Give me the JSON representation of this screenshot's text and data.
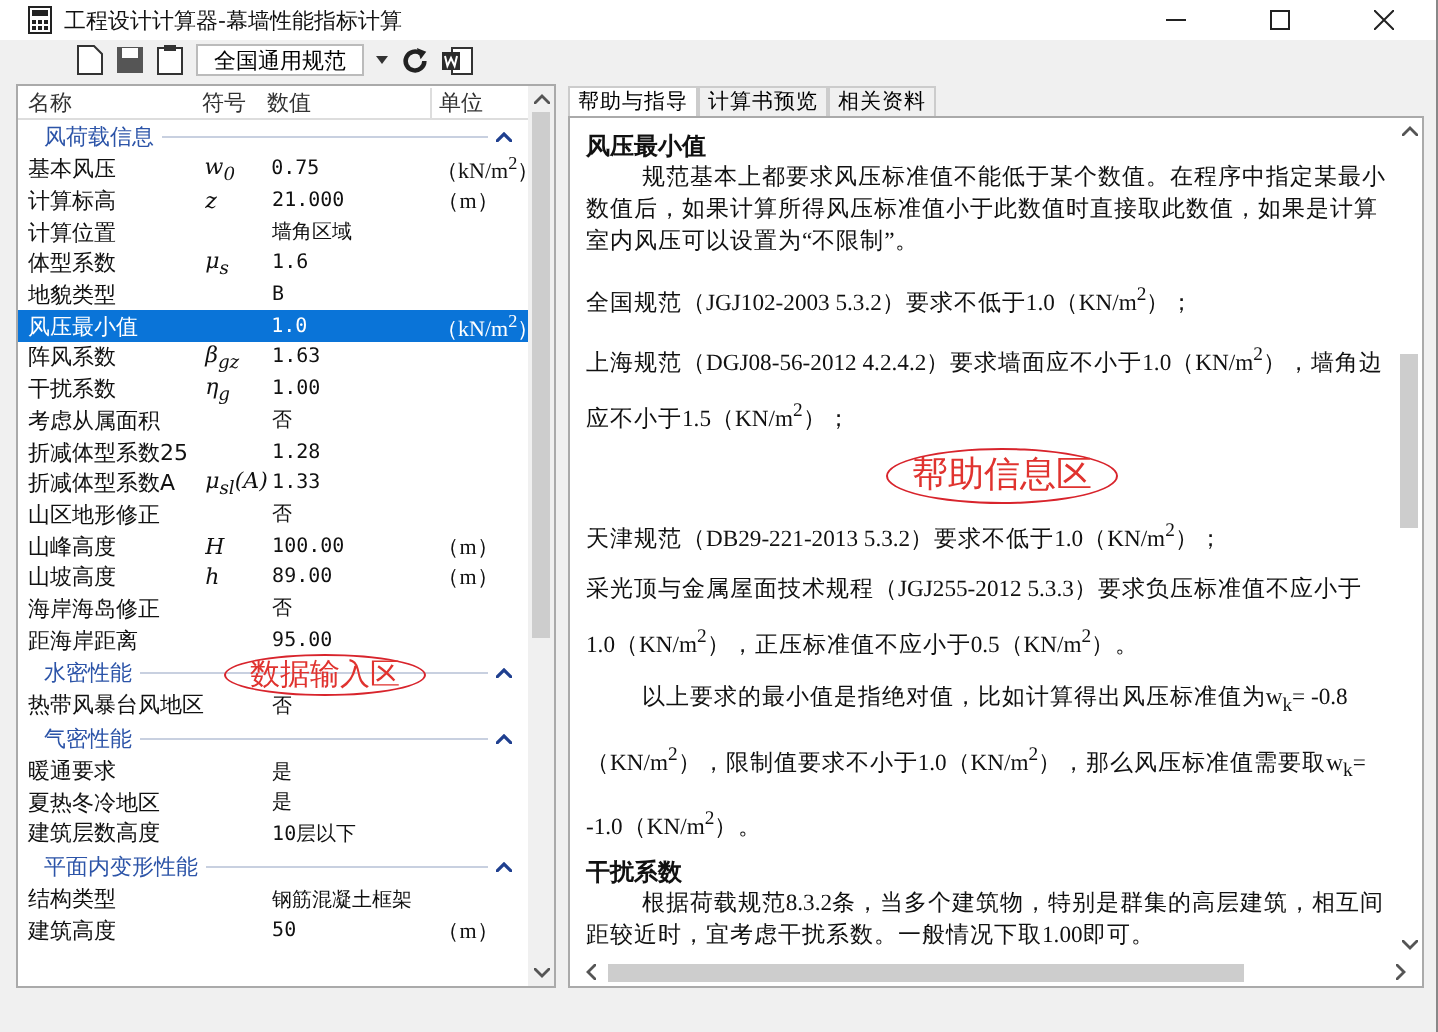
{
  "window": {
    "title": "工程设计计算器-幕墙性能指标计算"
  },
  "toolbar": {
    "standard": "全国通用规范"
  },
  "input_table": {
    "columns": [
      "名称",
      "符号",
      "数值",
      "单位"
    ],
    "sections": [
      {
        "title": "风荷载信息",
        "expanded": true,
        "rows": [
          {
            "name": "基本风压",
            "symbol": "w$_{0}$",
            "value": "0.75",
            "unit": "（kN/m$^{2}$）",
            "selected": false
          },
          {
            "name": "计算标高",
            "symbol": "z",
            "value": "21.000",
            "unit": "（m）",
            "selected": false
          },
          {
            "name": "计算位置",
            "symbol": "",
            "value": "墙角区域",
            "unit": "",
            "selected": false
          },
          {
            "name": "体型系数",
            "symbol": "μ$_{s}$",
            "value": "1.6",
            "unit": "",
            "selected": false
          },
          {
            "name": "地貌类型",
            "symbol": "",
            "value": "B",
            "unit": "",
            "selected": false
          },
          {
            "name": "风压最小值",
            "symbol": "",
            "value": "1.0",
            "unit": "（kN/m$^{2}$）",
            "selected": true
          },
          {
            "name": "阵风系数",
            "symbol": "β$_{gz}$",
            "value": "1.63",
            "unit": "",
            "selected": false
          },
          {
            "name": "干扰系数",
            "symbol": "η$_{g}$",
            "value": "1.00",
            "unit": "",
            "selected": false
          },
          {
            "name": "考虑从属面积",
            "symbol": "",
            "value": "否",
            "unit": "",
            "selected": false
          },
          {
            "name": "折减体型系数25",
            "symbol": "",
            "value": "1.28",
            "unit": "",
            "selected": false
          },
          {
            "name": "折减体型系数A",
            "symbol": "μ$_{sl}$(A)",
            "value": "1.33",
            "unit": "",
            "selected": false
          },
          {
            "name": "山区地形修正",
            "symbol": "",
            "value": "否",
            "unit": "",
            "selected": false
          },
          {
            "name": "山峰高度",
            "symbol": "H",
            "value": "100.00",
            "unit": "（m）",
            "selected": false
          },
          {
            "name": "山坡高度",
            "symbol": "h",
            "value": "89.00",
            "unit": "（m）",
            "selected": false
          },
          {
            "name": "海岸海岛修正",
            "symbol": "",
            "value": "否",
            "unit": "",
            "selected": false
          },
          {
            "name": "距海岸距离",
            "symbol": "",
            "value": "95.00",
            "unit": "",
            "selected": false
          }
        ]
      },
      {
        "title": "水密性能",
        "expanded": true,
        "rows": [
          {
            "name": "热带风暴台风地区",
            "symbol": "",
            "value": "否",
            "unit": "",
            "selected": false
          }
        ]
      },
      {
        "title": "气密性能",
        "expanded": true,
        "rows": [
          {
            "name": "暖通要求",
            "symbol": "",
            "value": "是",
            "unit": "",
            "selected": false
          },
          {
            "name": "夏热冬冷地区",
            "symbol": "",
            "value": "是",
            "unit": "",
            "selected": false
          },
          {
            "name": "建筑层数高度",
            "symbol": "",
            "value": "10层以下",
            "unit": "",
            "selected": false
          }
        ]
      },
      {
        "title": "平面内变形性能",
        "expanded": true,
        "rows": [
          {
            "name": "结构类型",
            "symbol": "",
            "value": "钢筋混凝土框架",
            "unit": "",
            "selected": false
          },
          {
            "name": "建筑高度",
            "symbol": "",
            "value": "50",
            "unit": "（m）",
            "selected": false
          }
        ]
      }
    ]
  },
  "tabs": [
    {
      "label": "帮助与指导",
      "selected": true
    },
    {
      "label": "计算书预览",
      "selected": false
    },
    {
      "label": "相关资料",
      "selected": false
    }
  ],
  "help": [
    {
      "kind": "heading",
      "text": "风压最小值"
    },
    {
      "kind": "indent",
      "text": "规范基本上都要求风压标准值不能低于某个数值。在程序中指定某最小数值后，如果计算所得风压标准值小于此数值时直接取此数值，如果是计算室内风压可以设置为“不限制”。"
    },
    {
      "kind": "loose",
      "text": "全国规范（JGJ102-2003 5.3.2）要求不低于1.0（KN/m$^{2}$）；"
    },
    {
      "kind": "loose",
      "text": "上海规范（DGJ08-56-2012  4.2.4.2）要求墙面应不小于1.0（KN/m$^{2}$），墙角边应不小于1.5（KN/m$^{2}$）；"
    },
    {
      "kind": "annotation",
      "text": "帮助信息区"
    },
    {
      "kind": "loose",
      "text": "天津规范（DB29-221-2013 5.3.2）要求不低于1.0（KN/m$^{2}$）；"
    },
    {
      "kind": "loose",
      "text": "采光顶与金属屋面技术规程（JGJ255-2012 5.3.3）要求负压标准值不应小于1.0（KN/m$^{2}$），正压标准值不应小于0.5（KN/m$^{2}$）。"
    },
    {
      "kind": "loose-indent",
      "text": "以上要求的最小值是指绝对值，比如计算得出风压标准值为w$_{k}$= -0.8（KN/m$^{2}$），限制值要求不小于1.0（KN/m$^{2}$），那么风压标准值需要取w$_{k}$= -1.0（KN/m$^{2}$）。"
    },
    {
      "kind": "heading",
      "text": "干扰系数"
    },
    {
      "kind": "indent",
      "text": "根据荷载规范8.3.2条，当多个建筑物，特别是群集的高层建筑，相互间距较近时，宜考虑干扰系数。一般情况下取1.00即可。"
    }
  ],
  "annotations": [
    {
      "text": "数据输入区"
    }
  ]
}
